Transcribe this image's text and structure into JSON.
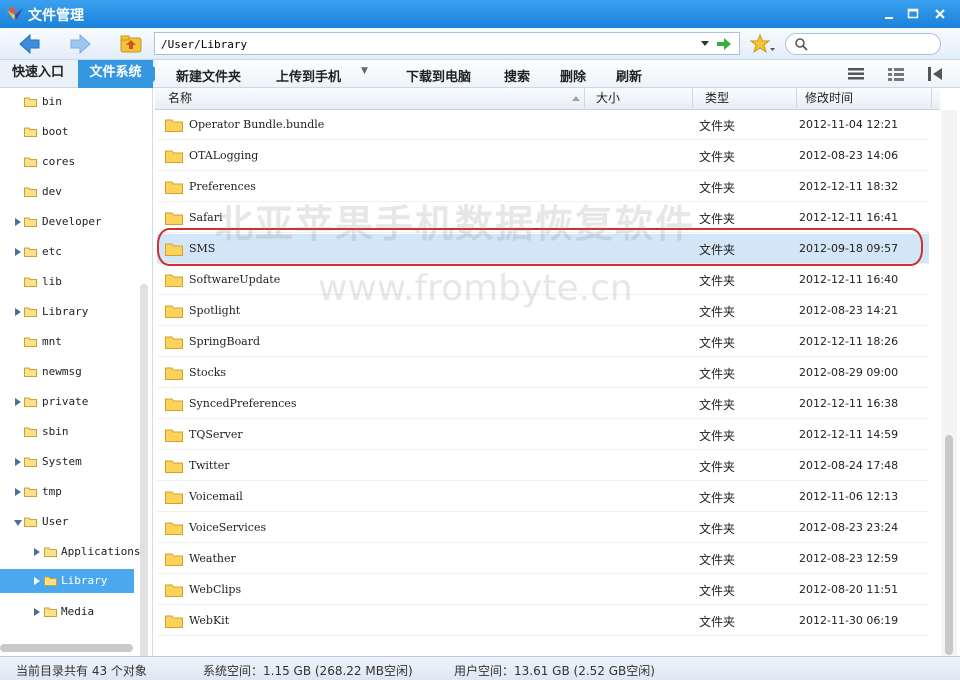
{
  "window": {
    "title": "文件管理"
  },
  "address": {
    "path": "/User/Library",
    "search_placeholder": ""
  },
  "tabs": {
    "quick": "快速入口",
    "filesystem": "文件系统"
  },
  "toolbar": {
    "new_folder": "新建文件夹",
    "upload": "上传到手机",
    "download": "下载到电脑",
    "search": "搜索",
    "delete": "删除",
    "refresh": "刷新"
  },
  "tree": {
    "items": [
      {
        "label": "bin"
      },
      {
        "label": "boot"
      },
      {
        "label": "cores"
      },
      {
        "label": "dev"
      },
      {
        "label": "Developer"
      },
      {
        "label": "etc"
      },
      {
        "label": "lib"
      },
      {
        "label": "Library"
      },
      {
        "label": "mnt"
      },
      {
        "label": "newmsg"
      },
      {
        "label": "private"
      },
      {
        "label": "sbin"
      },
      {
        "label": "System"
      },
      {
        "label": "tmp"
      },
      {
        "label": "User"
      },
      {
        "label": "Applications"
      },
      {
        "label": "Library"
      },
      {
        "label": "Media"
      }
    ]
  },
  "columns": {
    "name": "名称",
    "size": "大小",
    "type": "类型",
    "mtime": "修改时间"
  },
  "files": [
    {
      "name": "Operator Bundle.bundle",
      "type": "文件夹",
      "mtime": "2012-11-04 12:21"
    },
    {
      "name": "OTALogging",
      "type": "文件夹",
      "mtime": "2012-08-23 14:06"
    },
    {
      "name": "Preferences",
      "type": "文件夹",
      "mtime": "2012-12-11 18:32"
    },
    {
      "name": "Safari",
      "type": "文件夹",
      "mtime": "2012-12-11 16:41"
    },
    {
      "name": "SMS",
      "type": "文件夹",
      "mtime": "2012-09-18 09:57"
    },
    {
      "name": "SoftwareUpdate",
      "type": "文件夹",
      "mtime": "2012-12-11 16:40"
    },
    {
      "name": "Spotlight",
      "type": "文件夹",
      "mtime": "2012-08-23 14:21"
    },
    {
      "name": "SpringBoard",
      "type": "文件夹",
      "mtime": "2012-12-11 18:26"
    },
    {
      "name": "Stocks",
      "type": "文件夹",
      "mtime": "2012-08-29 09:00"
    },
    {
      "name": "SyncedPreferences",
      "type": "文件夹",
      "mtime": "2012-12-11 16:38"
    },
    {
      "name": "TQServer",
      "type": "文件夹",
      "mtime": "2012-12-11 14:59"
    },
    {
      "name": "Twitter",
      "type": "文件夹",
      "mtime": "2012-08-24 17:48"
    },
    {
      "name": "Voicemail",
      "type": "文件夹",
      "mtime": "2012-11-06 12:13"
    },
    {
      "name": "VoiceServices",
      "type": "文件夹",
      "mtime": "2012-08-23 23:24"
    },
    {
      "name": "Weather",
      "type": "文件夹",
      "mtime": "2012-08-23 12:59"
    },
    {
      "name": "WebClips",
      "type": "文件夹",
      "mtime": "2012-08-20 11:51"
    },
    {
      "name": "WebKit",
      "type": "文件夹",
      "mtime": "2012-11-30 06:19"
    }
  ],
  "watermark": {
    "line1": "北亚苹果手机数据恢复软件",
    "line2": "www.frombyte.cn"
  },
  "status": {
    "count": "当前目录共有 43 个对象",
    "system": "系统空间：1.15 GB (268.22 MB空闲)",
    "user": "用户空间：13.61 GB (2.52 GB空闲)"
  },
  "colors": {
    "titlebar": "#1b82dc",
    "selection": "#d2e6f7",
    "tree_selection": "#4aa8ef",
    "highlight": "#d03030"
  }
}
